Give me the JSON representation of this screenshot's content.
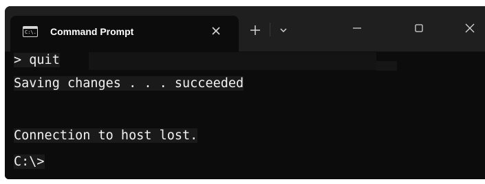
{
  "tab": {
    "icon": "command-prompt-icon",
    "icon_glyph": "C:\\.",
    "title": "Command Prompt",
    "close_icon": "close-icon"
  },
  "toolbar": {
    "new_tab_icon": "plus-icon",
    "dropdown_icon": "chevron-down-icon"
  },
  "window_controls": {
    "minimize_icon": "minimize-icon",
    "maximize_icon": "maximize-icon",
    "close_icon": "close-icon"
  },
  "console": {
    "lines": [
      "> quit",
      "Saving changes . . . succeeded",
      "",
      "Connection to host lost.",
      "C:\\>"
    ]
  },
  "colors": {
    "titlebar_bg": "#1f1f1f",
    "console_bg": "#0c0c0c",
    "console_text": "#f2f2f2",
    "highlight_bg": "#1a1a1a"
  }
}
